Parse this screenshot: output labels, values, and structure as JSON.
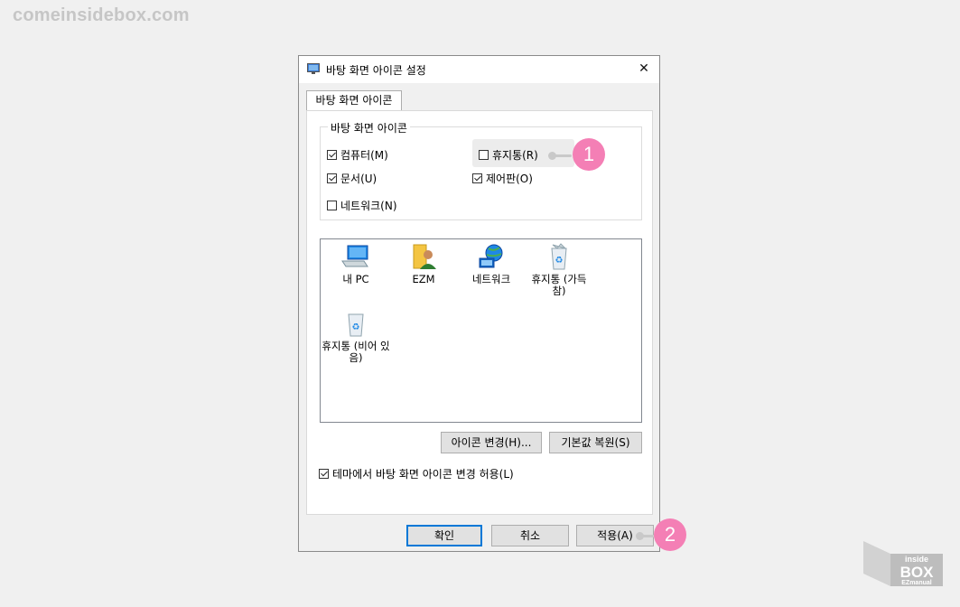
{
  "watermark": "comeinsidebox.com",
  "dialog": {
    "title": "바탕 화면 아이콘 설정",
    "close_glyph": "✕",
    "tab_label": "바탕 화면 아이콘",
    "group": {
      "legend": "바탕 화면 아이콘",
      "checkboxes": [
        {
          "label": "컴퓨터(M)",
          "checked": true
        },
        {
          "label": "휴지통(R)",
          "checked": false
        },
        {
          "label": "문서(U)",
          "checked": true
        },
        {
          "label": "제어판(O)",
          "checked": true
        },
        {
          "label": "네트워크(N)",
          "checked": false
        }
      ]
    },
    "icons": [
      {
        "label": "내 PC",
        "icon": "computer-icon"
      },
      {
        "label": "EZM",
        "icon": "user-folder-icon"
      },
      {
        "label": "네트워크",
        "icon": "network-icon"
      },
      {
        "label": "휴지통 (가득 참)",
        "icon": "recycle-bin-full-icon"
      },
      {
        "label": "휴지통 (비어 있음)",
        "icon": "recycle-bin-empty-icon"
      }
    ],
    "change_icon_button": "아이콘 변경(H)...",
    "restore_default_button": "기본값 복원(S)",
    "allow_theme_checkbox": {
      "label": "테마에서 바탕 화면 아이콘 변경 허용(L)",
      "checked": true
    },
    "ok_button": "확인",
    "cancel_button": "취소",
    "apply_button": "적용(A)"
  },
  "callouts": [
    "1",
    "2"
  ],
  "logo": {
    "line1": "inside",
    "line2": "BOX",
    "line3": "EZmanual"
  },
  "colors": {
    "callout": "#f47fb5",
    "accent": "#0078d7",
    "connector": "#c9c9c9"
  }
}
